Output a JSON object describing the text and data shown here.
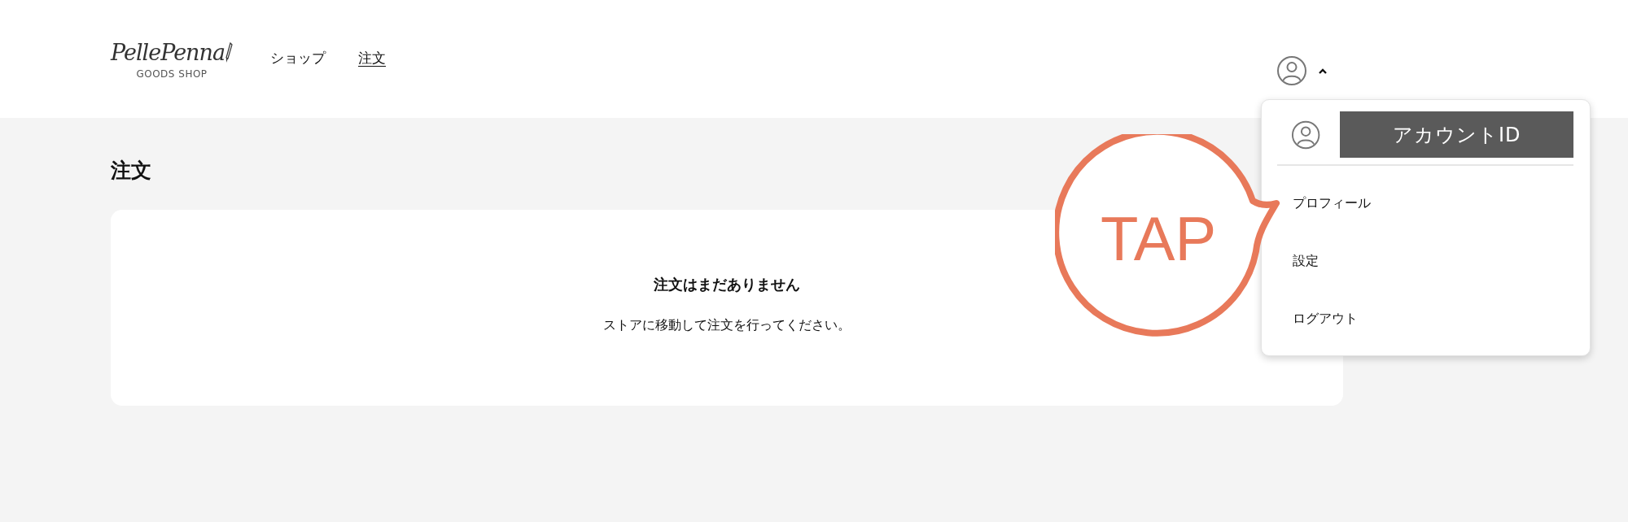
{
  "logo": {
    "script": "PellePenna",
    "subtitle": "GOODS SHOP"
  },
  "nav": [
    {
      "label": "ショップ",
      "selected": false
    },
    {
      "label": "注文",
      "selected": true
    }
  ],
  "account_menu": {
    "expanded": true,
    "account_id": "アカウントID",
    "items": [
      {
        "label": "プロフィール"
      },
      {
        "label": "設定"
      },
      {
        "label": "ログアウト"
      }
    ]
  },
  "page": {
    "title": "注文",
    "empty_title": "注文はまだありません",
    "empty_message": "ストアに移動して注文を行ってください。"
  },
  "callout": {
    "label": "TAP"
  }
}
